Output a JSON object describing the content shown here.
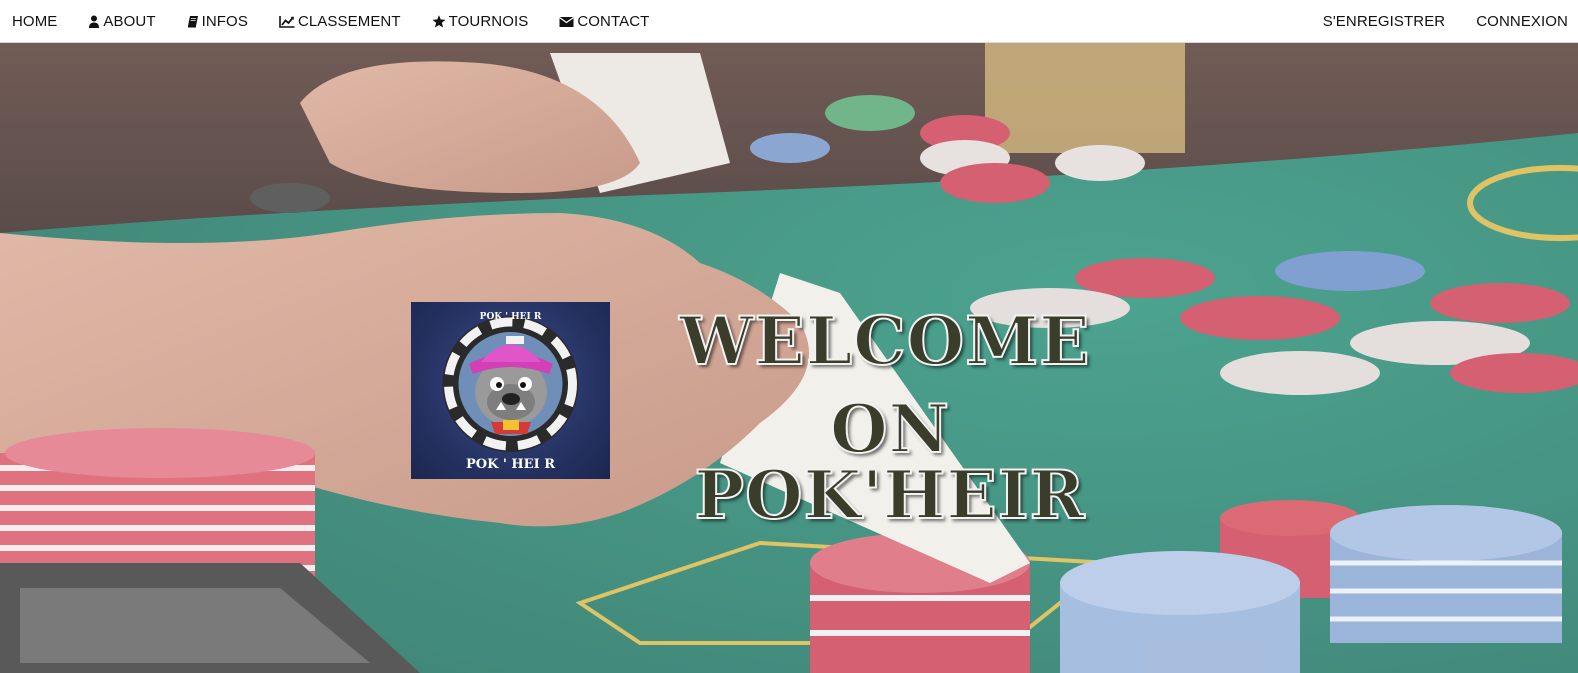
{
  "nav": {
    "left": [
      {
        "label": "HOME",
        "icon": ""
      },
      {
        "label": "ABOUT",
        "icon": "user-icon"
      },
      {
        "label": "INFOS",
        "icon": "book-icon"
      },
      {
        "label": "CLASSEMENT",
        "icon": "chart-line-icon"
      },
      {
        "label": "TOURNOIS",
        "icon": "star-icon"
      },
      {
        "label": "CONTACT",
        "icon": "envelope-icon"
      }
    ],
    "right": [
      {
        "label": "S'ENREGISTRER"
      },
      {
        "label": "CONNEXION"
      }
    ]
  },
  "hero": {
    "title_line1": "WELCOME",
    "title_line2": "ON POK'HEIR",
    "logo": {
      "text_top": "POK ' HEI R",
      "text_bottom": "POK ' HEI R"
    }
  },
  "colors": {
    "felt_green": "#0f7a62",
    "chip_red": "#c8344a",
    "chip_blue": "#5b86c4",
    "logo_bg": "#23305e"
  }
}
